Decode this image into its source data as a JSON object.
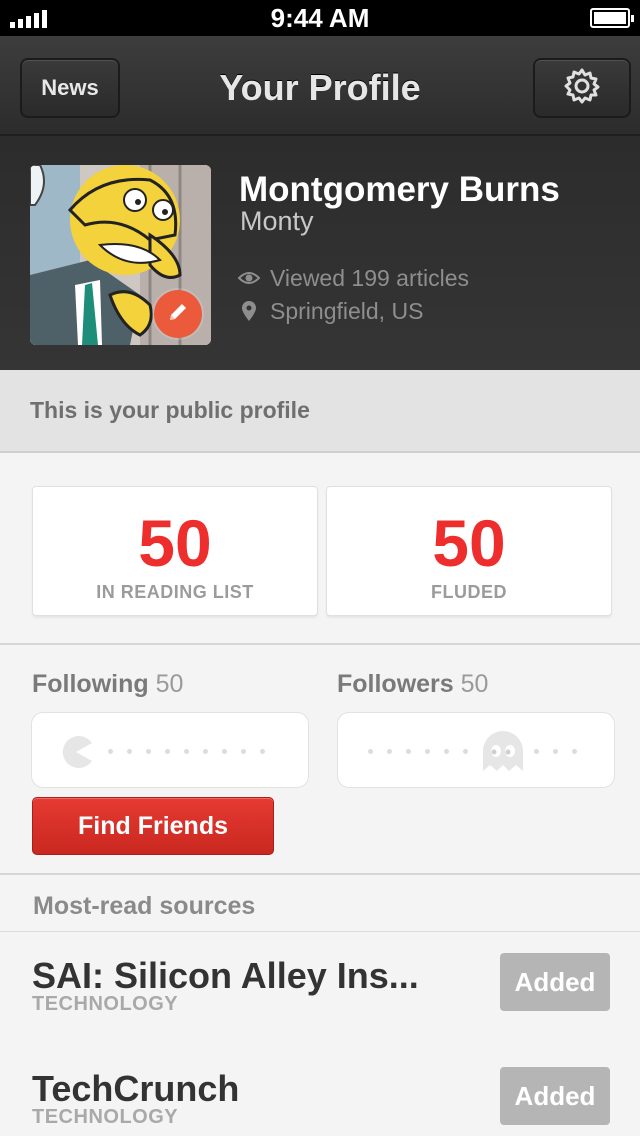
{
  "status_bar": {
    "time": "9:44 AM"
  },
  "nav": {
    "back_label": "News",
    "title": "Your Profile",
    "settings_icon": "gear-icon"
  },
  "profile": {
    "name": "Montgomery Burns",
    "nickname": "Monty",
    "viewed": "Viewed 199 articles",
    "location": "Springfield, US",
    "edit_icon": "pencil-icon"
  },
  "public_banner": "This is your public profile",
  "stats": {
    "reading_list": {
      "value": "50",
      "label": "IN READING LIST"
    },
    "fluded": {
      "value": "50",
      "label": "FLUDED"
    }
  },
  "social": {
    "following": {
      "label": "Following",
      "count": "50"
    },
    "followers": {
      "label": "Followers",
      "count": "50"
    },
    "find_friends_label": "Find Friends"
  },
  "sources": {
    "header": "Most-read sources",
    "items": [
      {
        "name": "SAI: Silicon Alley Ins...",
        "category": "TECHNOLOGY",
        "button": "Added"
      },
      {
        "name": "TechCrunch",
        "category": "TECHNOLOGY",
        "button": "Added"
      }
    ]
  },
  "colors": {
    "accent_red": "#ee2d2d",
    "button_red": "#d8302a",
    "nav_dark": "#333333",
    "added_gray": "#b5b5b5"
  }
}
